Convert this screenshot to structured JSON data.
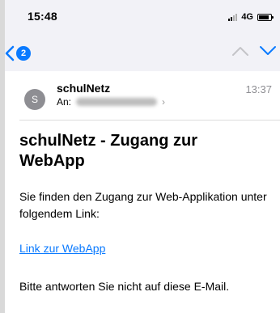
{
  "status_bar": {
    "time": "15:48",
    "network": "4G"
  },
  "nav": {
    "unread_count": "2"
  },
  "mail": {
    "avatar_initial": "S",
    "sender": "schulNetz",
    "to_label": "An:",
    "received_time": "13:37",
    "subject": "schulNetz - Zugang zur WebApp",
    "body_intro": "Sie finden den Zugang zur Web-Applikation unter folgendem Link:",
    "link_text": "Link zur WebApp",
    "footer_note": "Bitte antworten Sie nicht auf diese E-Mail."
  },
  "colors": {
    "accent": "#0a7aff",
    "avatar": "#8e8e93",
    "background": "#f2f2f7"
  },
  "icons": [
    "back-chevron-icon",
    "signal-icon",
    "battery-icon",
    "arrow-up-icon",
    "arrow-down-icon",
    "chevron-right-icon"
  ]
}
